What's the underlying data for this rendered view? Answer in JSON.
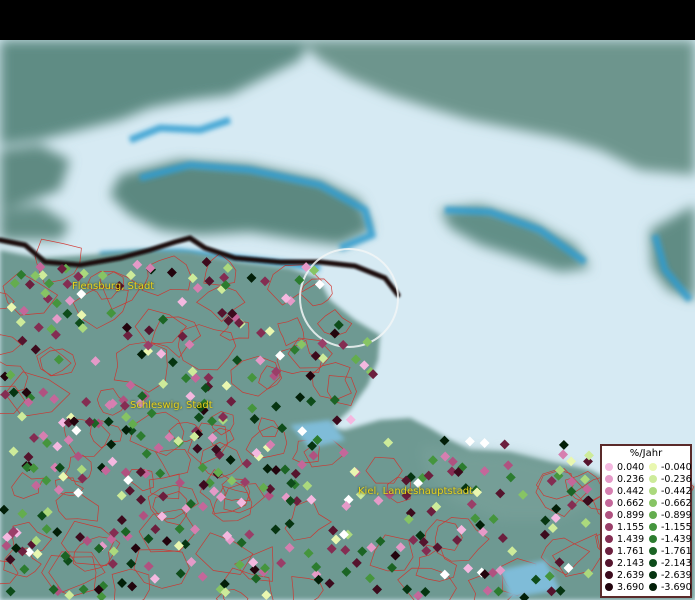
{
  "places": [
    {
      "id": "flensburg",
      "label": "Flensburg, Stadt"
    },
    {
      "id": "schleswig",
      "label": "Schleswig, Stadt"
    },
    {
      "id": "kiel",
      "label": "Kiel, Landeshauptstadt"
    }
  ],
  "legend": {
    "title": "%/Jahr",
    "positive": [
      {
        "value": "0.040",
        "color": "#f4b8e0"
      },
      {
        "value": "0.236",
        "color": "#e59ac8"
      },
      {
        "value": "0.442",
        "color": "#d67fb0"
      },
      {
        "value": "0.662",
        "color": "#c4679a"
      },
      {
        "value": "0.899",
        "color": "#b05280"
      },
      {
        "value": "1.155",
        "color": "#9a3e68"
      },
      {
        "value": "1.439",
        "color": "#842d52"
      },
      {
        "value": "1.761",
        "color": "#6c1f3e"
      },
      {
        "value": "2.143",
        "color": "#55142d"
      },
      {
        "value": "2.639",
        "color": "#3c0b1d"
      },
      {
        "value": "3.690",
        "color": "#22040d"
      }
    ],
    "negative": [
      {
        "value": "-0.040",
        "color": "#e9f7b0"
      },
      {
        "value": "-0.236",
        "color": "#cdeb9a"
      },
      {
        "value": "-0.442",
        "color": "#abd97d"
      },
      {
        "value": "-0.662",
        "color": "#87c464"
      },
      {
        "value": "-0.899",
        "color": "#64ad4e"
      },
      {
        "value": "-1.155",
        "color": "#45953d"
      },
      {
        "value": "-1.439",
        "color": "#2c7c2f"
      },
      {
        "value": "-1.761",
        "color": "#1b6424"
      },
      {
        "value": "-2.143",
        "color": "#0e4c1a"
      },
      {
        "value": "-2.639",
        "color": "#063511"
      },
      {
        "value": "-3.690",
        "color": "#021f08"
      }
    ]
  },
  "colors": {
    "land_dk": "#5f8c84",
    "sea": "#d8ecf4",
    "coast": "#2e9cd0",
    "borders": "#d2302a",
    "label": "#e6d21e"
  }
}
